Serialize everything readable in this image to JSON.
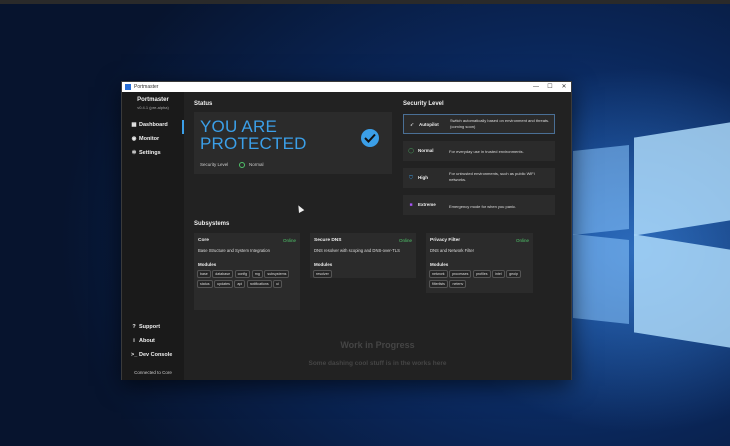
{
  "window": {
    "title": "Portmaster",
    "controls": {
      "minimize": "—",
      "maximize": "☐",
      "close": "✕"
    }
  },
  "sidebar": {
    "app_name": "Portmaster",
    "version": "v0.4.1 (pre-alpha)",
    "nav": [
      {
        "label": "Dashboard",
        "icon": "dashboard-icon"
      },
      {
        "label": "Monitor",
        "icon": "eye-icon"
      },
      {
        "label": "Settings",
        "icon": "gear-icon"
      }
    ],
    "footer_nav": [
      {
        "label": "Support",
        "icon": "question-icon"
      },
      {
        "label": "About",
        "icon": "info-icon"
      },
      {
        "label": "Dev Console",
        "icon": "terminal-icon"
      }
    ],
    "connection_status": "Connected to Core"
  },
  "status": {
    "heading": "Status",
    "headline": "YOU ARE PROTECTED",
    "security_level_label": "Security Level",
    "security_level_value": "Normal"
  },
  "security_level": {
    "heading": "Security Level",
    "levels": [
      {
        "name": "Autopilot",
        "icon": "rocket-icon",
        "description": "Switch automatically based on environment and threats. (coming soon)",
        "selected": true
      },
      {
        "name": "Normal",
        "icon": "circle-icon",
        "description": "For everyday use in trusted environments.",
        "selected": false
      },
      {
        "name": "High",
        "icon": "shield-icon",
        "description": "For untrusted environments, such as public WiFi networks.",
        "selected": false
      },
      {
        "name": "Extreme",
        "icon": "square-icon",
        "description": "Emergency mode for when you panic.",
        "selected": false
      }
    ]
  },
  "subsystems": {
    "heading": "Subsystems",
    "modules_label": "Modules",
    "items": [
      {
        "name": "Core",
        "status": "Online",
        "description": "Base Structure and System Integration",
        "modules": [
          "base",
          "database",
          "config",
          "rng",
          "subsystems",
          "status",
          "updates",
          "api",
          "notifications",
          "ui"
        ]
      },
      {
        "name": "Secure DNS",
        "status": "Online",
        "description": "DNS resolver with scoping and DNS-over-TLS",
        "modules": [
          "resolver"
        ]
      },
      {
        "name": "Privacy Filter",
        "status": "Online",
        "description": "DNS and Network Filter",
        "modules": [
          "network",
          "processes",
          "profiles",
          "intel",
          "geoip",
          "filterlists",
          "netenv"
        ]
      }
    ]
  },
  "work_in_progress": {
    "title": "Work in Progress",
    "subtitle": "Some dashing cool stuff is in the works here"
  },
  "colors": {
    "accent": "#3b9fe8",
    "online": "#4fc36a",
    "background": "#222222"
  }
}
